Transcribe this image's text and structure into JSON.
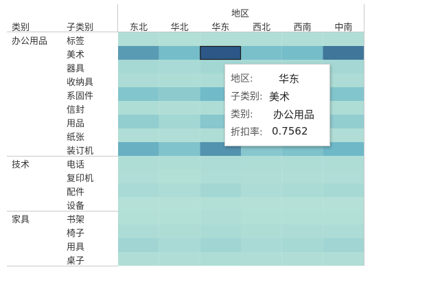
{
  "header": {
    "category_col": "类别",
    "subcategory_col": "子类别",
    "region_title": "地区"
  },
  "colors": {
    "scale_low": "#b9e3d8",
    "scale_high": "#2b5686",
    "selected_border": "#1a1a1a",
    "separator": "#c8c8c8"
  },
  "chart_data": {
    "type": "heatmap",
    "x_title": "地区",
    "regions": [
      "东北",
      "华北",
      "华东",
      "西北",
      "西南",
      "中南"
    ],
    "groups": [
      {
        "category": "办公用品",
        "subcategories": [
          "标签",
          "美术",
          "器具",
          "收纳具",
          "系固件",
          "信封",
          "用品",
          "纸张",
          "装订机"
        ]
      },
      {
        "category": "技术",
        "subcategories": [
          "电话",
          "复印机",
          "配件",
          "设备"
        ]
      },
      {
        "category": "家具",
        "subcategories": [
          "书架",
          "椅子",
          "用具",
          "桌子"
        ]
      }
    ],
    "values": [
      [
        0.05,
        0.04,
        0.05,
        0.05,
        0.05,
        0.05
      ],
      [
        0.52,
        0.38,
        0.7562,
        0.35,
        0.38,
        0.65
      ],
      [
        0.1,
        0.09,
        0.12,
        0.1,
        0.1,
        0.11
      ],
      [
        0.07,
        0.06,
        0.07,
        0.07,
        0.07,
        0.07
      ],
      [
        0.3,
        0.25,
        0.4,
        0.25,
        0.25,
        0.3
      ],
      [
        0.06,
        0.05,
        0.06,
        0.06,
        0.06,
        0.06
      ],
      [
        0.22,
        0.12,
        0.28,
        0.12,
        0.15,
        0.22
      ],
      [
        0.05,
        0.05,
        0.06,
        0.05,
        0.05,
        0.05
      ],
      [
        0.45,
        0.32,
        0.55,
        0.28,
        0.33,
        0.42
      ],
      [
        0.06,
        0.06,
        0.07,
        0.06,
        0.06,
        0.06
      ],
      [
        0.05,
        0.04,
        0.06,
        0.05,
        0.05,
        0.05
      ],
      [
        0.09,
        0.07,
        0.12,
        0.07,
        0.08,
        0.1
      ],
      [
        0.03,
        0.03,
        0.04,
        0.03,
        0.03,
        0.03
      ],
      [
        0.04,
        0.04,
        0.05,
        0.04,
        0.04,
        0.04
      ],
      [
        0.07,
        0.06,
        0.08,
        0.06,
        0.07,
        0.07
      ],
      [
        0.14,
        0.09,
        0.14,
        0.09,
        0.1,
        0.14
      ],
      [
        0.05,
        0.05,
        0.06,
        0.05,
        0.05,
        0.05
      ]
    ],
    "selected": {
      "row": 1,
      "col": 2
    },
    "measure": "折扣率"
  },
  "tooltip": {
    "region_label": "地区:",
    "region_value": "华东",
    "subcategory_label": "子类别:",
    "subcategory_value": "美术",
    "category_label": "类别:",
    "category_value": "办公用品",
    "discount_label": "折扣率:",
    "discount_value": "0.7562"
  }
}
